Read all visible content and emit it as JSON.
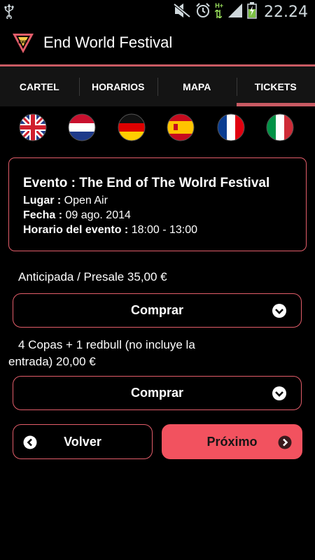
{
  "status_bar": {
    "time": "22.24",
    "network_label": "H+",
    "icons": [
      "usb-icon",
      "mute-icon",
      "alarm-icon",
      "signal-icon",
      "battery-charging-icon"
    ]
  },
  "app": {
    "title": "End World Festival",
    "logo_text": "EWF"
  },
  "tabs": [
    {
      "label": "CARTEL",
      "active": false
    },
    {
      "label": "HORARIOS",
      "active": false
    },
    {
      "label": "MAPA",
      "active": false
    },
    {
      "label": "TICKETS",
      "active": true
    }
  ],
  "languages": [
    "english",
    "dutch",
    "german",
    "spanish",
    "french",
    "italian"
  ],
  "event": {
    "title": "Evento : The End of The Wolrd Festival",
    "lugar_label": "Lugar :",
    "lugar_value": "Open Air",
    "fecha_label": "Fecha :",
    "fecha_value": "09 ago. 2014",
    "horario_label": "Horario del evento :",
    "horario_value": "18:00 - 13:00"
  },
  "tickets": [
    {
      "description": "Anticipada / Presale 35,00 €",
      "action_label": "Comprar"
    },
    {
      "description": "4 Copas + 1 redbull (no incluye la entrada) 20,00 €",
      "action_label": "Comprar"
    }
  ],
  "nav": {
    "back_label": "Volver",
    "next_label": "Próximo"
  },
  "colors": {
    "accent": "#e35d6a",
    "button_fill": "#f2525f",
    "background": "#000000"
  }
}
